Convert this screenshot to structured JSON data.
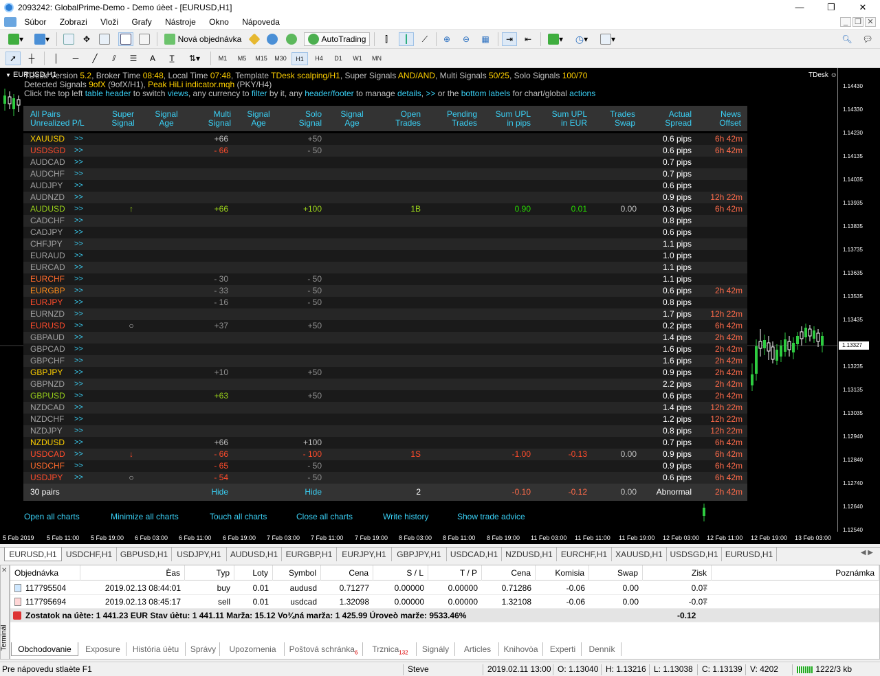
{
  "window": {
    "title": "2093242: GlobalPrime-Demo - Demo úèet - [EURUSD,H1]"
  },
  "menu": [
    "Súbor",
    "Zobrazi",
    "Vloži",
    "Grafy",
    "Nástroje",
    "Okno",
    "Nápoveda"
  ],
  "toolbar": {
    "new_order": "Nová objednávka",
    "autotrading": "AutoTrading",
    "timeframes": [
      "M1",
      "M5",
      "M15",
      "M30",
      "H1",
      "H4",
      "D1",
      "W1",
      "MN"
    ],
    "active_timeframe": "H1"
  },
  "chart": {
    "symbol_label": "EURUSD,H1",
    "tdesk_label": "TDesk",
    "info_line1_parts": [
      "TDesk Version ",
      "5.2",
      ", Broker Time ",
      "08:48",
      ", Local Time ",
      "07:48",
      ", Template ",
      "TDesk scalping/H1",
      ", Super Signals ",
      "AND/AND",
      ", Multi Signals ",
      "50/25",
      ", Solo Signals ",
      "100/70"
    ],
    "info_line2_parts": [
      "Detected Signals ",
      "9ofX",
      " (9ofX/H1), ",
      "Peak HiLi indicator.mqh",
      " (PKY/H4)"
    ],
    "info_line3_parts": [
      "Click the top left ",
      "table header",
      " to switch ",
      "views",
      ", any currency to ",
      "filter",
      " by it, any ",
      "header/footer",
      " to manage ",
      "details",
      ", ",
      ">>",
      " or the ",
      "bottom labels",
      " for chart/global ",
      "actions"
    ],
    "price_labels": [
      "1.14430",
      "1.14330",
      "1.14230",
      "1.14135",
      "1.14035",
      "1.13935",
      "1.13835",
      "1.13735",
      "1.13635",
      "1.13535",
      "1.13435",
      "1.13327",
      "1.13235",
      "1.13135",
      "1.13035",
      "1.12940",
      "1.12840",
      "1.12740",
      "1.12640",
      "1.12540"
    ],
    "current_price": "1.13327",
    "time_labels": [
      "5 Feb 2019",
      "5 Feb 11:00",
      "5 Feb 19:00",
      "6 Feb 03:00",
      "6 Feb 11:00",
      "6 Feb 19:00",
      "7 Feb 03:00",
      "7 Feb 11:00",
      "7 Feb 19:00",
      "8 Feb 03:00",
      "8 Feb 11:00",
      "8 Feb 19:00",
      "11 Feb 03:00",
      "11 Feb 11:00",
      "11 Feb 19:00",
      "12 Feb 03:00",
      "12 Feb 11:00",
      "12 Feb 19:00",
      "13 Feb 03:00"
    ]
  },
  "dashboard": {
    "headers": [
      [
        "All Pairs",
        "Unrealized P/L"
      ],
      [
        "Super",
        "Signal"
      ],
      [
        "Signal",
        "Age"
      ],
      [
        "Multi",
        "Signal"
      ],
      [
        "Signal",
        "Age"
      ],
      [
        "Solo",
        "Signal"
      ],
      [
        "Signal",
        "Age"
      ],
      [
        "Open",
        "Trades"
      ],
      [
        "Pending",
        "Trades"
      ],
      [
        "Sum UPL",
        "in pips"
      ],
      [
        "Sum UPL",
        "in EUR"
      ],
      [
        "Trades",
        "Swap"
      ],
      [
        "Actual",
        "Spread"
      ],
      [
        "News",
        "Offset"
      ]
    ],
    "rows": [
      {
        "pair": "XAUUSD",
        "color": "#ffd000",
        "super": "",
        "multi": "+66",
        "mc": "#c0c0c0",
        "solo": "+50",
        "sc": "#909090",
        "open": "",
        "upl": "",
        "uple": "",
        "swap": "",
        "spread": "0.6 pips",
        "news": "6h 42m"
      },
      {
        "pair": "USDSGD",
        "color": "#ff4b2b",
        "super": "",
        "multi": "- 66",
        "mc": "#ff4b2b",
        "solo": "- 50",
        "sc": "#909090",
        "open": "",
        "upl": "",
        "uple": "",
        "swap": "",
        "spread": "0.6 pips",
        "news": "6h 42m"
      },
      {
        "pair": "AUDCAD",
        "color": "#a0a0a0",
        "super": "",
        "multi": "",
        "mc": "",
        "solo": "",
        "sc": "",
        "open": "",
        "upl": "",
        "uple": "",
        "swap": "",
        "spread": "0.7 pips",
        "news": ""
      },
      {
        "pair": "AUDCHF",
        "color": "#a0a0a0",
        "super": "",
        "multi": "",
        "mc": "",
        "solo": "",
        "sc": "",
        "open": "",
        "upl": "",
        "uple": "",
        "swap": "",
        "spread": "0.7 pips",
        "news": ""
      },
      {
        "pair": "AUDJPY",
        "color": "#a0a0a0",
        "super": "",
        "multi": "",
        "mc": "",
        "solo": "",
        "sc": "",
        "open": "",
        "upl": "",
        "uple": "",
        "swap": "",
        "spread": "0.6 pips",
        "news": ""
      },
      {
        "pair": "AUDNZD",
        "color": "#a0a0a0",
        "super": "",
        "multi": "",
        "mc": "",
        "solo": "",
        "sc": "",
        "open": "",
        "upl": "",
        "uple": "",
        "swap": "",
        "spread": "0.9 pips",
        "news": "12h 22m"
      },
      {
        "pair": "AUDUSD",
        "color": "#9ad21a",
        "super": "↑",
        "supc": "#9ad21a",
        "multi": "+66",
        "mc": "#9ad21a",
        "solo": "+100",
        "sc": "#9ad21a",
        "open": "1B",
        "oc": "#9ad21a",
        "upl": "0.90",
        "uplc": "#27d900",
        "uple": "0.01",
        "swap": "0.00",
        "spread": "0.3 pips",
        "news": "6h 42m"
      },
      {
        "pair": "CADCHF",
        "color": "#a0a0a0",
        "super": "",
        "multi": "",
        "mc": "",
        "solo": "",
        "sc": "",
        "open": "",
        "upl": "",
        "uple": "",
        "swap": "",
        "spread": "0.8 pips",
        "news": ""
      },
      {
        "pair": "CADJPY",
        "color": "#a0a0a0",
        "super": "",
        "multi": "",
        "mc": "",
        "solo": "",
        "sc": "",
        "open": "",
        "upl": "",
        "uple": "",
        "swap": "",
        "spread": "0.6 pips",
        "news": ""
      },
      {
        "pair": "CHFJPY",
        "color": "#a0a0a0",
        "super": "",
        "multi": "",
        "mc": "",
        "solo": "",
        "sc": "",
        "open": "",
        "upl": "",
        "uple": "",
        "swap": "",
        "spread": "1.1 pips",
        "news": ""
      },
      {
        "pair": "EURAUD",
        "color": "#a0a0a0",
        "super": "",
        "multi": "",
        "mc": "",
        "solo": "",
        "sc": "",
        "open": "",
        "upl": "",
        "uple": "",
        "swap": "",
        "spread": "1.0 pips",
        "news": ""
      },
      {
        "pair": "EURCAD",
        "color": "#a0a0a0",
        "super": "",
        "multi": "",
        "mc": "",
        "solo": "",
        "sc": "",
        "open": "",
        "upl": "",
        "uple": "",
        "swap": "",
        "spread": "1.1 pips",
        "news": ""
      },
      {
        "pair": "EURCHF",
        "color": "#ff6a2b",
        "super": "",
        "multi": "- 30",
        "mc": "#909090",
        "solo": "- 50",
        "sc": "#909090",
        "open": "",
        "upl": "",
        "uple": "",
        "swap": "",
        "spread": "1.1 pips",
        "news": ""
      },
      {
        "pair": "EURGBP",
        "color": "#ff8c1a",
        "super": "",
        "multi": "- 33",
        "mc": "#909090",
        "solo": "- 50",
        "sc": "#909090",
        "open": "",
        "upl": "",
        "uple": "",
        "swap": "",
        "spread": "0.6 pips",
        "news": "2h 42m"
      },
      {
        "pair": "EURJPY",
        "color": "#ff4b2b",
        "super": "",
        "multi": "- 16",
        "mc": "#909090",
        "solo": "- 50",
        "sc": "#909090",
        "open": "",
        "upl": "",
        "uple": "",
        "swap": "",
        "spread": "0.8 pips",
        "news": ""
      },
      {
        "pair": "EURNZD",
        "color": "#a0a0a0",
        "super": "",
        "multi": "",
        "mc": "",
        "solo": "",
        "sc": "",
        "open": "",
        "upl": "",
        "uple": "",
        "swap": "",
        "spread": "1.7 pips",
        "news": "12h 22m"
      },
      {
        "pair": "EURUSD",
        "color": "#ff4b2b",
        "super": "○",
        "supc": "#c0c0c0",
        "multi": "+37",
        "mc": "#909090",
        "solo": "+50",
        "sc": "#909090",
        "open": "",
        "upl": "",
        "uple": "",
        "swap": "",
        "spread": "0.2 pips",
        "news": "6h 42m"
      },
      {
        "pair": "GBPAUD",
        "color": "#a0a0a0",
        "super": "",
        "multi": "",
        "mc": "",
        "solo": "",
        "sc": "",
        "open": "",
        "upl": "",
        "uple": "",
        "swap": "",
        "spread": "1.4 pips",
        "news": "2h 42m"
      },
      {
        "pair": "GBPCAD",
        "color": "#a0a0a0",
        "super": "",
        "multi": "",
        "mc": "",
        "solo": "",
        "sc": "",
        "open": "",
        "upl": "",
        "uple": "",
        "swap": "",
        "spread": "1.6 pips",
        "news": "2h 42m"
      },
      {
        "pair": "GBPCHF",
        "color": "#a0a0a0",
        "super": "",
        "multi": "",
        "mc": "",
        "solo": "",
        "sc": "",
        "open": "",
        "upl": "",
        "uple": "",
        "swap": "",
        "spread": "1.6 pips",
        "news": "2h 42m"
      },
      {
        "pair": "GBPJPY",
        "color": "#ffd000",
        "super": "",
        "multi": "+10",
        "mc": "#909090",
        "solo": "+50",
        "sc": "#909090",
        "open": "",
        "upl": "",
        "uple": "",
        "swap": "",
        "spread": "0.9 pips",
        "news": "2h 42m"
      },
      {
        "pair": "GBPNZD",
        "color": "#a0a0a0",
        "super": "",
        "multi": "",
        "mc": "",
        "solo": "",
        "sc": "",
        "open": "",
        "upl": "",
        "uple": "",
        "swap": "",
        "spread": "2.2 pips",
        "news": "2h 42m"
      },
      {
        "pair": "GBPUSD",
        "color": "#9ad21a",
        "super": "",
        "multi": "+63",
        "mc": "#9ad21a",
        "solo": "+50",
        "sc": "#909090",
        "open": "",
        "upl": "",
        "uple": "",
        "swap": "",
        "spread": "0.6 pips",
        "news": "2h 42m"
      },
      {
        "pair": "NZDCAD",
        "color": "#a0a0a0",
        "super": "",
        "multi": "",
        "mc": "",
        "solo": "",
        "sc": "",
        "open": "",
        "upl": "",
        "uple": "",
        "swap": "",
        "spread": "1.4 pips",
        "news": "12h 22m"
      },
      {
        "pair": "NZDCHF",
        "color": "#a0a0a0",
        "super": "",
        "multi": "",
        "mc": "",
        "solo": "",
        "sc": "",
        "open": "",
        "upl": "",
        "uple": "",
        "swap": "",
        "spread": "1.2 pips",
        "news": "12h 22m"
      },
      {
        "pair": "NZDJPY",
        "color": "#a0a0a0",
        "super": "",
        "multi": "",
        "mc": "",
        "solo": "",
        "sc": "",
        "open": "",
        "upl": "",
        "uple": "",
        "swap": "",
        "spread": "0.8 pips",
        "news": "12h 22m"
      },
      {
        "pair": "NZDUSD",
        "color": "#ffd000",
        "super": "",
        "multi": "+66",
        "mc": "#c0c0c0",
        "solo": "+100",
        "sc": "#c0c0c0",
        "open": "",
        "upl": "",
        "uple": "",
        "swap": "",
        "spread": "0.7 pips",
        "news": "6h 42m"
      },
      {
        "pair": "USDCAD",
        "color": "#ff4b2b",
        "super": "↓",
        "supc": "#ff4b2b",
        "multi": "- 66",
        "mc": "#ff4b2b",
        "solo": "- 100",
        "sc": "#ff4b2b",
        "open": "1S",
        "oc": "#ff4b2b",
        "upl": "-1.00",
        "uplc": "#ff4b2b",
        "uple": "-0.13",
        "swap": "0.00",
        "spread": "0.9 pips",
        "news": "6h 42m"
      },
      {
        "pair": "USDCHF",
        "color": "#ff6a2b",
        "super": "",
        "multi": "- 65",
        "mc": "#ff4b2b",
        "solo": "- 50",
        "sc": "#909090",
        "open": "",
        "upl": "",
        "uple": "",
        "swap": "",
        "spread": "0.9 pips",
        "news": "6h 42m"
      },
      {
        "pair": "USDJPY",
        "color": "#ff4b2b",
        "super": "○",
        "supc": "#c0c0c0",
        "multi": "- 54",
        "mc": "#ff4b2b",
        "solo": "- 50",
        "sc": "#909090",
        "open": "",
        "upl": "",
        "uple": "",
        "swap": "",
        "spread": "0.6 pips",
        "news": "6h 42m"
      }
    ],
    "footer": {
      "pairs": "30 pairs",
      "multi": "Hide",
      "solo": "Hide",
      "open": "2",
      "upl": "-0.10",
      "uple": "-0.12",
      "swap": "0.00",
      "spread": "Abnormal",
      "news": "2h 42m"
    },
    "bottom_links": [
      "Open all charts",
      "Minimize all charts",
      "Touch all charts",
      "Close all charts",
      "Write history",
      "Show trade advice"
    ]
  },
  "chart_tabs": [
    "EURUSD,H1",
    "USDCHF,H1",
    "GBPUSD,H1",
    "USDJPY,H1",
    "AUDUSD,H1",
    "EURGBP,H1",
    "EURJPY,H1",
    "GBPJPY,H1",
    "USDCAD,H1",
    "NZDUSD,H1",
    "EURCHF,H1",
    "XAUUSD,H1",
    "USDSGD,H1",
    "EURUSD,H1"
  ],
  "terminal": {
    "label": "Terminál",
    "headers": [
      "Objednávka",
      "Èas",
      "Typ",
      "Loty",
      "Symbol",
      "Cena",
      "S / L",
      "T / P",
      "Cena",
      "Komisia",
      "Swap",
      "Zisk",
      "Poznámka"
    ],
    "rows": [
      [
        "117795504",
        "2019.02.13 08:44:01",
        "buy",
        "0.01",
        "audusd",
        "0.71277",
        "0.00000",
        "0.00000",
        "0.71286",
        "-0.06",
        "0.00",
        "0.07"
      ],
      [
        "117795694",
        "2019.02.13 08:45:17",
        "sell",
        "0.01",
        "usdcad",
        "1.32098",
        "0.00000",
        "0.00000",
        "1.32108",
        "-0.06",
        "0.00",
        "-0.07"
      ]
    ],
    "summary": "Zostatok na úète: 1 441.23 EUR  Stav úètu: 1 441.11  Marža: 15.12  Vo¾ná marža: 1 425.99  Úroveò marže: 9533.46%",
    "summary_profit": "-0.12",
    "tabs": [
      "Obchodovanie",
      "Exposure",
      "História úètu",
      "Správy",
      "Upozornenia",
      "Poštová schránka",
      "Trznica",
      "Signály",
      "Articles",
      "Knihovòa",
      "Experti",
      "Denník"
    ],
    "mailbox_badge": "6",
    "market_badge": "132"
  },
  "status": {
    "help": "Pre nápovedu stlaète F1",
    "profile": "Steve",
    "datetime": "2019.02.11 13:00",
    "open": "O: 1.13040",
    "high": "H: 1.13216",
    "low": "L: 1.13038",
    "close": "C: 1.13139",
    "volume": "V: 4202",
    "traffic": "1222/3 kb"
  }
}
